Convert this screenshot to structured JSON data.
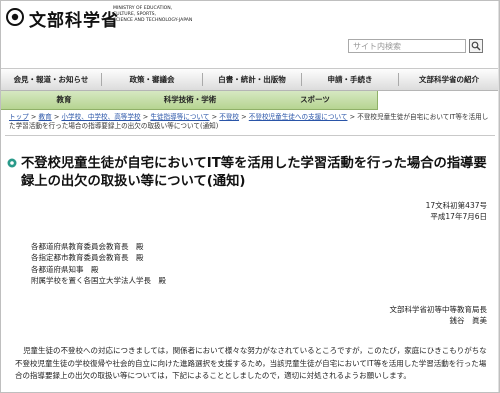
{
  "header": {
    "logo_text": "文部科学省",
    "logo_sub_lines": [
      "MINISTRY OF EDUCATION,",
      "CULTURE, SPORTS,",
      "SCIENCE AND TECHNOLOGY-JAPAN"
    ],
    "search_placeholder": "サイト内検索"
  },
  "global_nav": {
    "items": [
      {
        "label": "会見・報道・お知らせ"
      },
      {
        "label": "政策・審議会"
      },
      {
        "label": "白書・統計・出版物"
      },
      {
        "label": "申請・手続き"
      },
      {
        "label": "文部科学省の紹介"
      }
    ]
  },
  "sub_nav": {
    "items": [
      {
        "label": "教育",
        "active": false
      },
      {
        "label": "科学技術・学術",
        "active": false
      },
      {
        "label": "スポーツ",
        "active": false
      },
      {
        "label": "",
        "active": true
      }
    ]
  },
  "breadcrumb": {
    "items": [
      {
        "label": "トップ",
        "link": true
      },
      {
        "label": "教育",
        "link": true
      },
      {
        "label": "小学校、中学校、高等学校",
        "link": true
      },
      {
        "label": "生徒指導等について",
        "link": true
      },
      {
        "label": "不登校",
        "link": true
      },
      {
        "label": "不登校児童生徒への支援について",
        "link": true
      },
      {
        "label": "不登校児童生徒が自宅においてIT等を活用した学習活動を行った場合の指導要録上の出欠の取扱い等について(通知)",
        "link": false
      }
    ],
    "separator": ">"
  },
  "page": {
    "title": "不登校児童生徒が自宅においてIT等を活用した学習活動を行った場合の指導要録上の出欠の取扱い等について(通知)",
    "doc_number": "17文科初第437号",
    "date": "平成17年7月6日",
    "addressees": [
      "各都道府県教育委員会教育長　殿",
      "各指定都市教育委員会教育長　殿",
      "各都道府県知事　殿",
      "附属学校を置く各国立大学法人学長　殿"
    ],
    "sender_org": "文部科学省初等中等教育局長",
    "sender_name": "銭谷　眞美",
    "body": "児童生徒の不登校への対応につきましては，関係者において様々な努力がなされているところですが，このたび，家庭にひきこもりがちな不登校児童生徒の学校復帰や社会的自立に向けた進路選択を支援するため，当該児童生徒が自宅においてIT等を活用した学習活動を行った場合の指導要録上の出欠の取扱い等については，下記によることとしましたので，適切に対処されるようお願いします。"
  },
  "colors": {
    "subnav_green": "#b6d491",
    "link_blue": "#2a55a8",
    "bullet_teal": "#2a9a8a"
  }
}
